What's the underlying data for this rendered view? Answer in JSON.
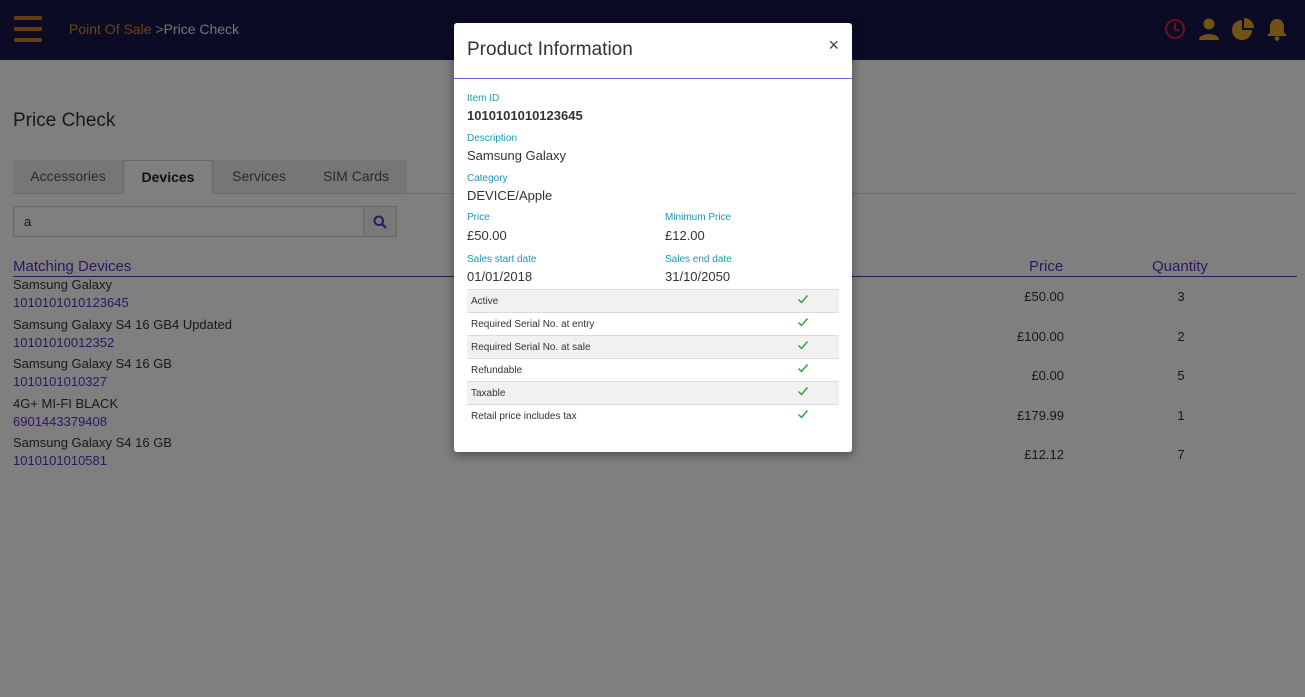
{
  "header": {
    "breadcrumb_root": "Point Of Sale",
    "breadcrumb_sep": ">",
    "breadcrumb_current": "Price Check",
    "icons": [
      "clock-icon",
      "user-icon",
      "pie-chart-icon",
      "bell-icon"
    ]
  },
  "page": {
    "title": "Price Check",
    "tabs": [
      {
        "label": "Accessories"
      },
      {
        "label": "Devices"
      },
      {
        "label": "Services"
      },
      {
        "label": "SIM Cards"
      }
    ],
    "search": {
      "value": "a"
    },
    "list": {
      "header_name": "Matching Devices",
      "header_price": "Price",
      "header_qty": "Quantity",
      "rows": [
        {
          "name": "Samsung Galaxy",
          "code": "1010101010123645",
          "price": "£50.00",
          "qty": "3"
        },
        {
          "name": "Samsung Galaxy S4 16 GB4 Updated",
          "code": "10101010012352",
          "price": "£100.00",
          "qty": "2"
        },
        {
          "name": "Samsung Galaxy S4 16 GB",
          "code": "1010101010327",
          "price": "£0.00",
          "qty": "5"
        },
        {
          "name": "4G+ MI-FI BLACK",
          "code": "6901443379408",
          "price": "£179.99",
          "qty": "1"
        },
        {
          "name": "Samsung Galaxy S4 16 GB",
          "code": "1010101010581",
          "price": "£12.12",
          "qty": "7"
        }
      ]
    }
  },
  "modal": {
    "title": "Product Information",
    "close": "×",
    "item_id_label": "Item ID",
    "item_id": "1010101010123645",
    "description_label": "Description",
    "description": "Samsung Galaxy",
    "category_label": "Category",
    "category": "DEVICE/Apple",
    "price_label": "Price",
    "price": "£50.00",
    "min_price_label": "Minimum Price",
    "min_price": "£12.00",
    "start_label": "Sales start date",
    "start": "01/01/2018",
    "end_label": "Sales end date",
    "end": "31/10/2050",
    "flags": [
      {
        "label": "Active",
        "check": "✓"
      },
      {
        "label": "Required Serial No. at entry",
        "check": "✓"
      },
      {
        "label": "Required Serial No. at sale",
        "check": "✓"
      },
      {
        "label": "Refundable",
        "check": "✓"
      },
      {
        "label": "Taxable",
        "check": "✓"
      },
      {
        "label": "Retail price includes tax",
        "check": "✓"
      }
    ]
  },
  "colors": {
    "topbar": "#16164d",
    "accent_orange": "#d08a2a",
    "purple": "#5b2fc2",
    "teal_label": "#1a9bb0",
    "check_green": "#2e9e3e"
  }
}
